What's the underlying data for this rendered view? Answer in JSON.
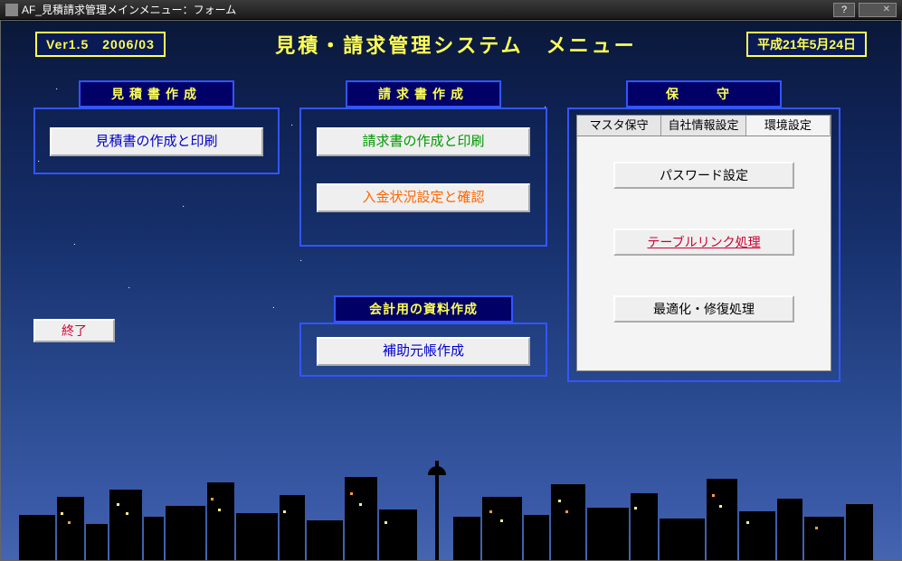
{
  "titlebar": {
    "text": "AF_見積請求管理メインメニュー：フォーム",
    "help": "?"
  },
  "header": {
    "version": "Ver1.5　2006/03",
    "system_title": "見積・請求管理システム　メニュー",
    "date": "平成21年5月24日"
  },
  "sections": {
    "estimate_head": "見積書作成",
    "billing_head": "請求書作成",
    "accounting_head": "会計用の資料作成",
    "maintenance_head": "保　守"
  },
  "buttons": {
    "estimate_create": "見積書の作成と印刷",
    "billing_create": "請求書の作成と印刷",
    "payment_status": "入金状況設定と確認",
    "subledger": "補助元帳作成",
    "exit": "終了"
  },
  "tabs": {
    "master": "マスタ保守",
    "company": "自社情報設定",
    "env": "環境設定"
  },
  "env_buttons": {
    "password": "パスワード設定",
    "tablelink": "テーブルリンク処理",
    "optimize": "最適化・修復処理"
  }
}
